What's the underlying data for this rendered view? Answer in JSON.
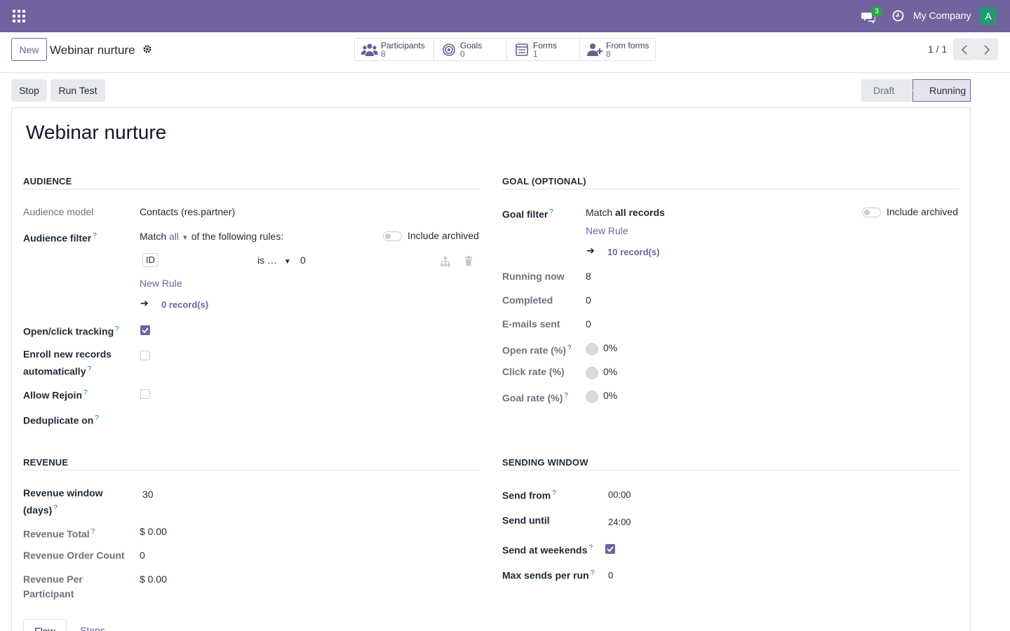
{
  "navbar": {
    "company": "My Company",
    "chat_count": "3",
    "avatar_letter": "A"
  },
  "control_panel": {
    "new_label": "New",
    "breadcrumb": "Webinar nurture",
    "smart_buttons": [
      {
        "label": "Participants",
        "value": "8",
        "icon": "users-icon"
      },
      {
        "label": "Goals",
        "value": "0",
        "icon": "target-icon"
      },
      {
        "label": "Forms",
        "value": "1",
        "icon": "form-icon"
      },
      {
        "label": "From forms",
        "value": "8",
        "icon": "user-plus-icon"
      }
    ],
    "pager": "1 / 1"
  },
  "statusbar": {
    "stop_label": "Stop",
    "run_test_label": "Run Test",
    "stages": [
      "Draft",
      "Running"
    ],
    "active_stage": "Running"
  },
  "form": {
    "title": "Webinar nurture",
    "audience": {
      "section_title": "AUDIENCE",
      "model_label": "Audience model",
      "model_value": "Contacts (res.partner)",
      "filter_label": "Audience filter",
      "match_prefix": "Match",
      "match_mode": "all",
      "match_suffix": "of the following rules:",
      "include_archived_label": "Include archived",
      "rule": {
        "field": "ID",
        "operator": "is …",
        "value": "0"
      },
      "new_rule_label": "New Rule",
      "records_label": "0 record(s)",
      "tracking_label": "Open/click tracking",
      "tracking_checked": true,
      "enroll_label_line1": "Enroll new records",
      "enroll_label_line2": "automatically",
      "enroll_checked": false,
      "rejoin_label": "Allow Rejoin",
      "rejoin_checked": false,
      "dedup_label": "Deduplicate on"
    },
    "goal": {
      "section_title": "GOAL (OPTIONAL)",
      "filter_label": "Goal filter",
      "match_prefix": "Match",
      "match_value": "all records",
      "include_archived_label": "Include archived",
      "new_rule_label": "New Rule",
      "records_label": "10 record(s)",
      "running_now_label": "Running now",
      "running_now": "8",
      "completed_label": "Completed",
      "completed": "0",
      "emails_sent_label": "E-mails sent",
      "emails_sent": "0",
      "open_rate_label": "Open rate (%)",
      "open_rate": "0%",
      "click_rate_label": "Click rate (%)",
      "click_rate": "0%",
      "goal_rate_label": "Goal rate (%)",
      "goal_rate": "0%"
    },
    "revenue": {
      "section_title": "REVENUE",
      "window_label_line1": "Revenue window",
      "window_label_line2": "(days)",
      "window_value": "30",
      "total_label": "Revenue Total",
      "total_value": "$ 0.00",
      "order_count_label": "Revenue Order Count",
      "order_count_value": "0",
      "per_participant_label_line1": "Revenue Per",
      "per_participant_label_line2": "Participant",
      "per_participant_value": "$ 0.00"
    },
    "sending_window": {
      "section_title": "SENDING WINDOW",
      "send_from_label": "Send from",
      "send_from": "00:00",
      "send_until_label": "Send until",
      "send_until": "24:00",
      "weekends_label": "Send at weekends",
      "weekends_checked": true,
      "max_sends_label": "Max sends per run",
      "max_sends": "0"
    },
    "tabs": [
      "Flow",
      "Steps"
    ]
  },
  "colors": {
    "brand": "#71639e",
    "navbar": "#71639e",
    "badge": "#28a745",
    "help": "#017e84"
  }
}
